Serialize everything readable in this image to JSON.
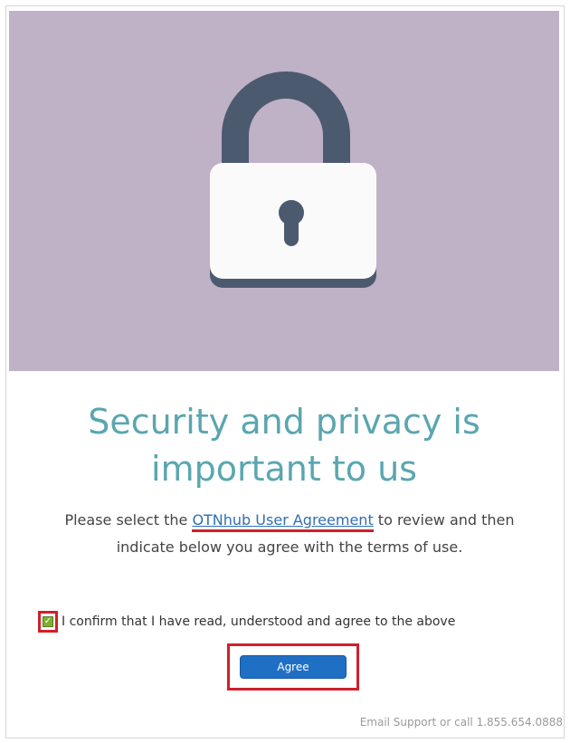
{
  "hero": {
    "background_color": "#bfb1c6",
    "icon": "padlock-icon"
  },
  "heading": {
    "line1": "Security and privacy is",
    "line2": "important to us"
  },
  "description": {
    "before_link": "Please select the ",
    "link_text": "OTNhub User Agreement",
    "after_link": " to review and then indicate below you agree with the terms of use."
  },
  "confirm": {
    "checked": true,
    "label": "I confirm that I have read, understood and agree to the above"
  },
  "agree_button": {
    "label": "Agree"
  },
  "footer": {
    "support_text": "Email Support or call 1.855.654.0888"
  },
  "colors": {
    "heading": "#5aa6b0",
    "link": "#2f6fb3",
    "button": "#1f6fc5",
    "highlight": "#d11f2b",
    "checkbox": "#7fae36"
  }
}
